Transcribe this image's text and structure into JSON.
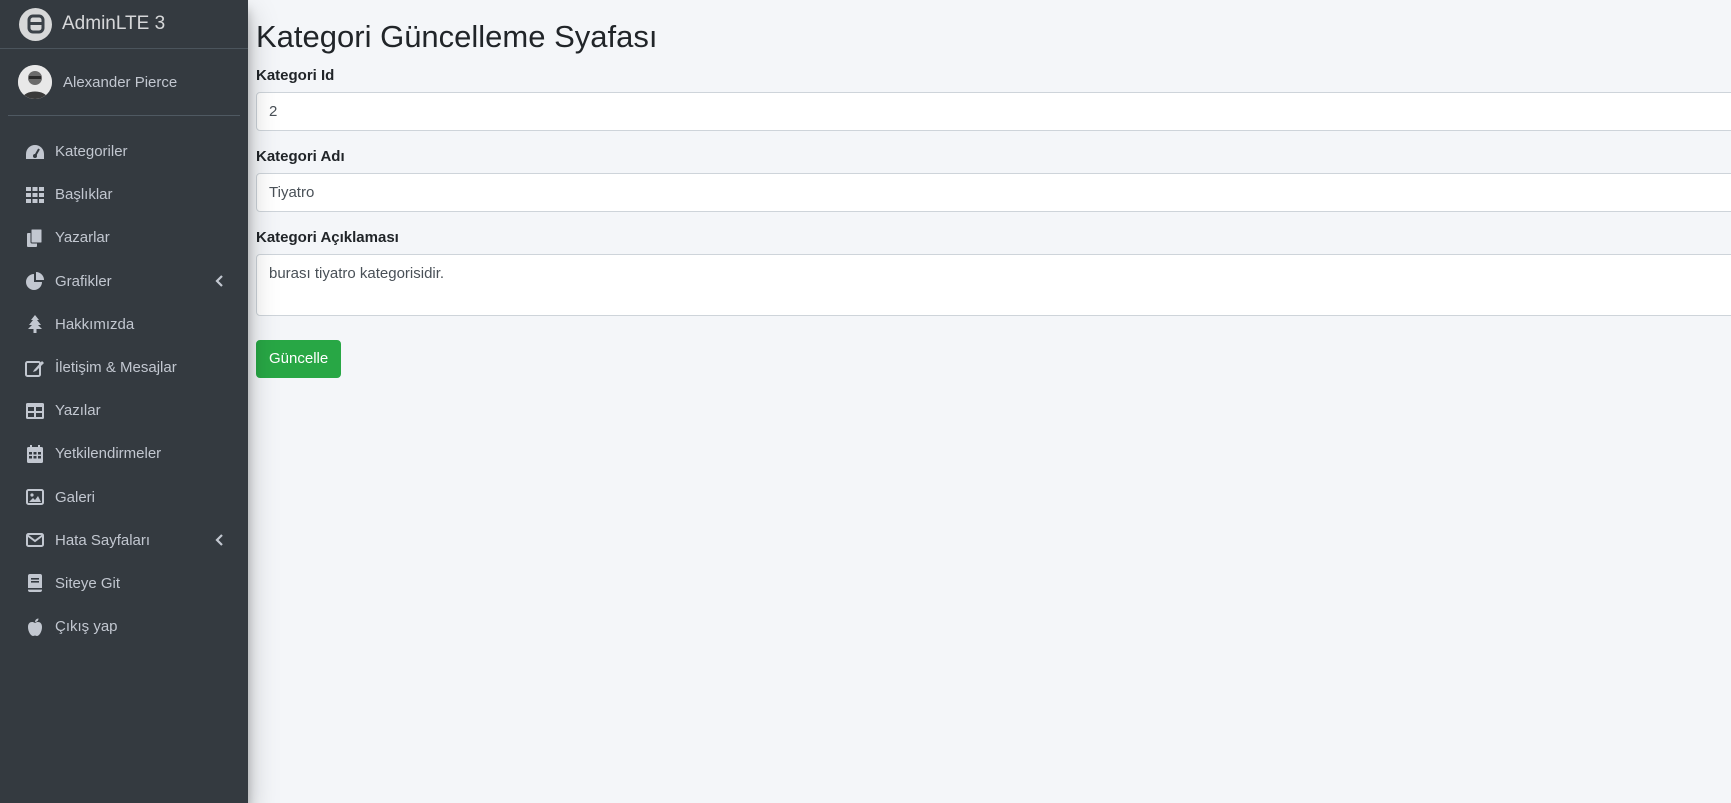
{
  "brand": {
    "title": "AdminLTE 3",
    "logo_icon": "adminlte-logo-icon"
  },
  "user": {
    "name": "Alexander Pierce",
    "avatar_icon": "user-avatar"
  },
  "sidebar": {
    "items": [
      {
        "label": "Kategoriler",
        "icon": "tachometer-icon"
      },
      {
        "label": "Başlıklar",
        "icon": "grid-icon"
      },
      {
        "label": "Yazarlar",
        "icon": "copy-icon"
      },
      {
        "label": "Grafikler",
        "icon": "pie-chart-icon",
        "has_submenu": true
      },
      {
        "label": "Hakkımızda",
        "icon": "tree-icon"
      },
      {
        "label": "İletişim & Mesajlar",
        "icon": "edit-icon"
      },
      {
        "label": "Yazılar",
        "icon": "table-icon"
      },
      {
        "label": "Yetkilendirmeler",
        "icon": "calendar-icon"
      },
      {
        "label": "Galeri",
        "icon": "image-icon"
      },
      {
        "label": "Hata Sayfaları",
        "icon": "envelope-icon",
        "has_submenu": true
      },
      {
        "label": "Siteye Git",
        "icon": "book-icon"
      },
      {
        "label": "Çıkış yap",
        "icon": "apple-icon"
      }
    ]
  },
  "page": {
    "title": "Kategori Güncelleme Syafası",
    "form": {
      "id_label": "Kategori Id",
      "id_value": "2",
      "name_label": "Kategori Adı",
      "name_value": "Tiyatro",
      "desc_label": "Kategori Açıklaması",
      "desc_value": "burası tiyatro kategorisidir.",
      "submit_label": "Güncelle"
    }
  },
  "colors": {
    "sidebar_bg": "#343a40",
    "content_bg": "#f4f6f9",
    "success": "#28a745",
    "sidebar_text": "#c2c7d0"
  }
}
